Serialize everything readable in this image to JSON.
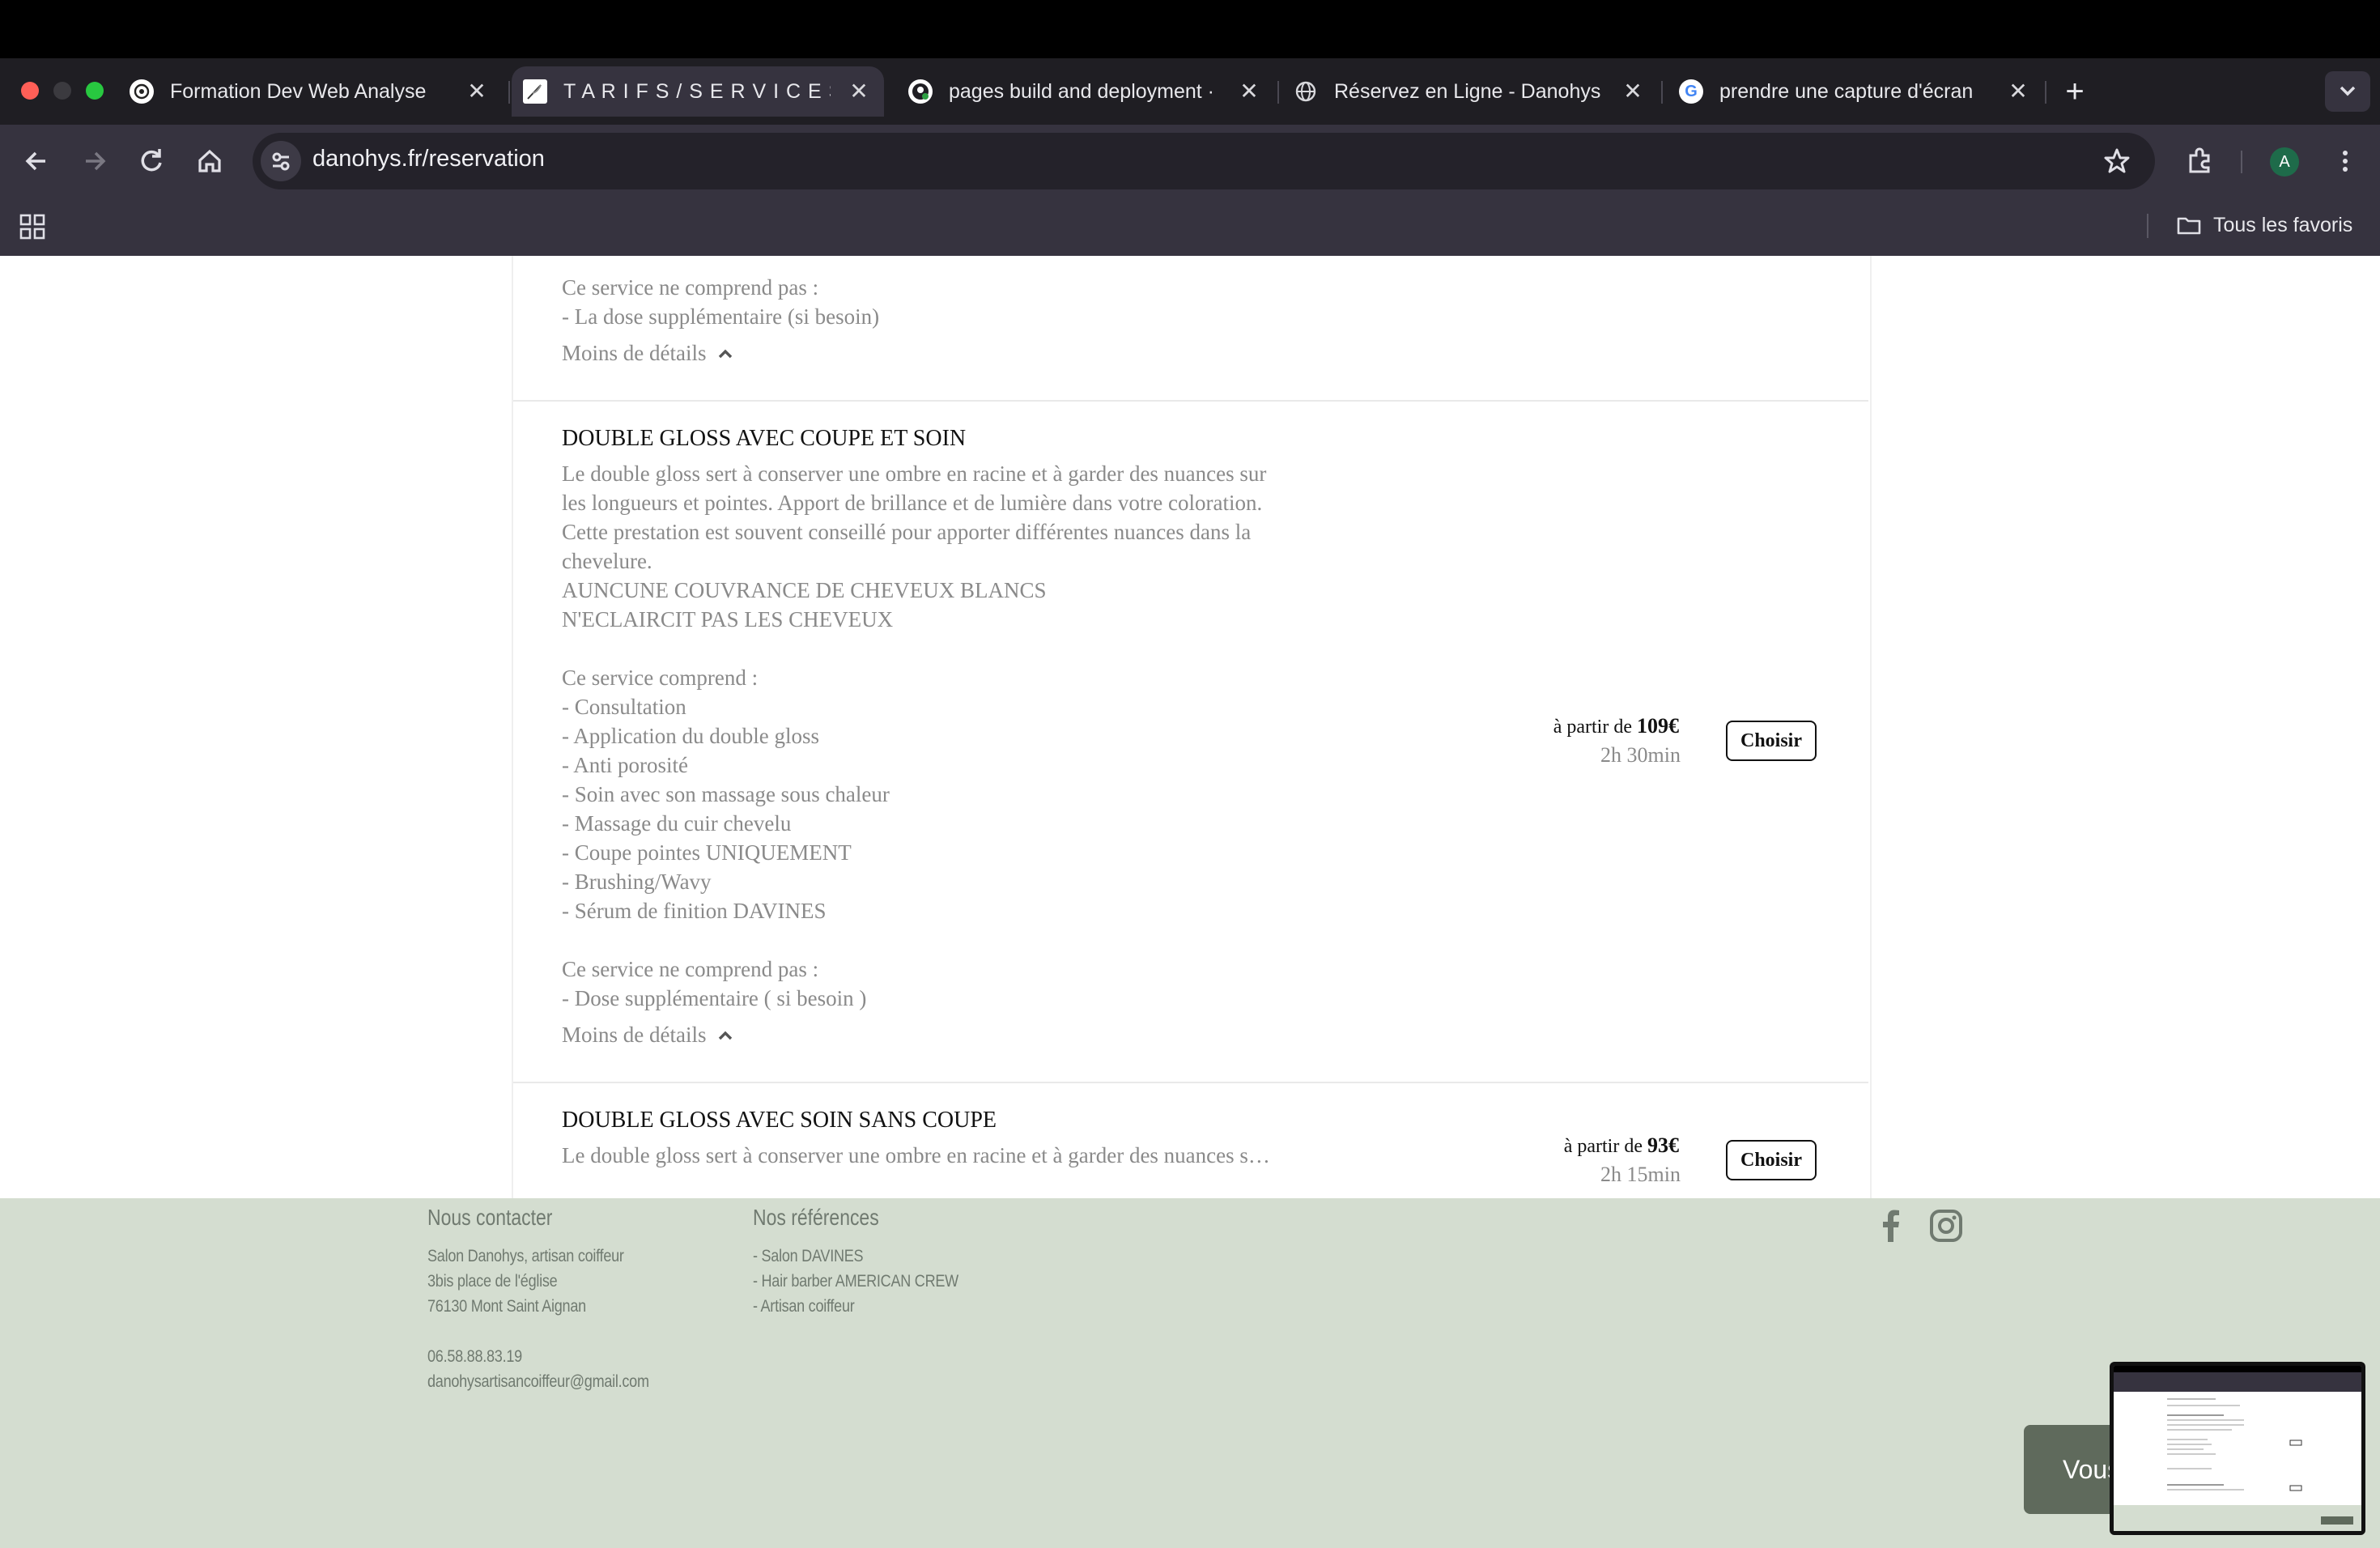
{
  "browser": {
    "tabs": [
      {
        "title": "Formation Dev Web Analyse",
        "favicon": "openai-icon"
      },
      {
        "title": "T A R I F S / S E R V I C E S | D",
        "favicon": "feather-icon",
        "active": true
      },
      {
        "title": "pages build and deployment ·",
        "favicon": "github-icon"
      },
      {
        "title": "Réservez en Ligne - Danohys",
        "favicon": "globe-icon"
      },
      {
        "title": "prendre une capture d'écran",
        "favicon": "google-icon"
      }
    ],
    "new_tab": "+",
    "url": "danohys.fr/reservation",
    "profile_initial": "A",
    "bookmarks_folder": "Tous les favoris",
    "colors": {
      "tabstrip": "#1f1e23",
      "toolbar": "#36333f",
      "omnibox": "#24222a",
      "traffic_red": "#ff5f57",
      "traffic_yellow": "#3b3a3f",
      "traffic_green": "#28c840"
    }
  },
  "services": {
    "prev_tail": {
      "lines": [
        "Ce service ne comprend pas :",
        "- La dose supplémentaire (si besoin)"
      ],
      "toggle": "Moins de détails"
    },
    "item1": {
      "title": "DOUBLE GLOSS AVEC COUPE ET SOIN",
      "lines": [
        "Le double gloss sert à conserver une ombre en racine et à garder des nuances sur",
        "les longueurs et pointes. Apport de brillance et de lumière dans votre coloration.",
        "Cette prestation est souvent conseillé pour apporter différentes nuances dans la",
        "chevelure.",
        "AUNCUNE COUVRANCE DE CHEVEUX BLANCS",
        "N'ECLAIRCIT PAS LES CHEVEUX",
        "",
        "Ce service comprend :",
        "- Consultation",
        "- Application du double gloss",
        "- Anti porosité",
        "- Soin avec son massage sous chaleur",
        "- Massage du cuir chevelu",
        "- Coupe pointes UNIQUEMENT",
        "- Brushing/Wavy",
        "- Sérum de finition DAVINES",
        "",
        "Ce service ne comprend pas :",
        "- Dose supplémentaire ( si besoin )"
      ],
      "toggle": "Moins de détails",
      "price_prefix": "à partir de",
      "price": "109€",
      "duration": "2h 30min",
      "button": "Choisir"
    },
    "item2": {
      "title": "DOUBLE GLOSS AVEC SOIN SANS COUPE",
      "summary": "Le double gloss sert à conserver une ombre en racine et à garder des nuances s…",
      "price_prefix": "à partir de",
      "price": "93€",
      "duration": "2h 15min",
      "button": "Choisir"
    }
  },
  "footer": {
    "contact": {
      "heading": "Nous contacter",
      "lines": [
        "Salon Danohys, artisan coiffeur",
        "3bis place de l'église",
        "76130 Mont Saint Aignan",
        "",
        "06.58.88.83.19",
        "danohysartisancoiffeur@gmail.com"
      ]
    },
    "refs": {
      "heading": "Nos références",
      "lines": [
        "- Salon DAVINES",
        "- Hair barber AMERICAN CREW",
        "- Artisan coiffeur"
      ]
    },
    "chat_label": "Vous",
    "bg": "#d4ddd0"
  }
}
